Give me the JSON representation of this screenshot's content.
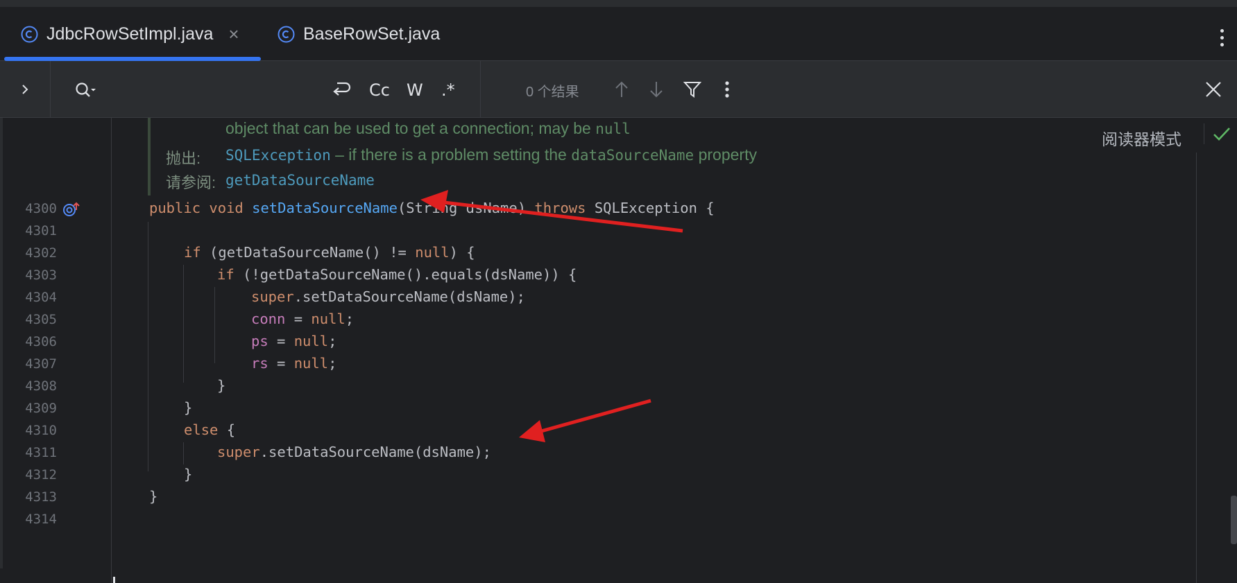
{
  "tabs": [
    {
      "label": "JdbcRowSetImpl.java",
      "active": true,
      "closable": true
    },
    {
      "label": "BaseRowSet.java",
      "active": false,
      "closable": false
    }
  ],
  "tab_close_glyph": "×",
  "search": {
    "toggles": {
      "wrap": "⤶",
      "case": "Cc",
      "word": "W",
      "regex": ".*"
    },
    "results": "0 个结果"
  },
  "doc": {
    "line1": "object that can be used to get a connection; may be ",
    "line1_code": "null",
    "throws_label": "抛出:",
    "throws_code": "SQLException",
    "throws_text_a": " – if there is a problem setting the ",
    "throws_code2": "dataSourceName",
    "throws_text_b": " property",
    "see_label": "请参阅:",
    "see_link": "getDataSourceName"
  },
  "reader_mode": "阅读器模式",
  "line_numbers": [
    "4300",
    "4301",
    "4302",
    "4303",
    "4304",
    "4305",
    "4306",
    "4307",
    "4308",
    "4309",
    "4310",
    "4311",
    "4312",
    "4313",
    "4314"
  ],
  "code": {
    "l4300": {
      "kw1": "public void ",
      "fn": "setDataSourceName",
      "rest1": "(String dsName) ",
      "kw2": "throws",
      "rest2": " SQLException {"
    },
    "l4302": {
      "kw": "if",
      "rest": " (getDataSourceName() != ",
      "kw2": "null",
      "rest2": ") {"
    },
    "l4303": {
      "kw": "if",
      "rest": " (!getDataSourceName().equals(dsName)) {"
    },
    "l4304": {
      "kw": "super",
      "rest": ".setDataSourceName(dsName);"
    },
    "l4305": {
      "fld": "conn",
      "rest": " = ",
      "kw": "null",
      "end": ";"
    },
    "l4306": {
      "fld": "ps",
      "rest": " = ",
      "kw": "null",
      "end": ";"
    },
    "l4307": {
      "fld": "rs",
      "rest": " = ",
      "kw": "null",
      "end": ";"
    },
    "l4308": "}",
    "l4309": "}",
    "l4310": {
      "kw": "else",
      "rest": " {"
    },
    "l4311": {
      "kw": "super",
      "rest": ".setDataSourceName(dsName);"
    },
    "l4312": "}",
    "l4313": "}"
  },
  "colors": {
    "accent": "#3574f0",
    "keyword": "#cf8e6d",
    "method": "#56a8f5",
    "field": "#c77dbb",
    "annotation_arrow": "#e02020"
  }
}
